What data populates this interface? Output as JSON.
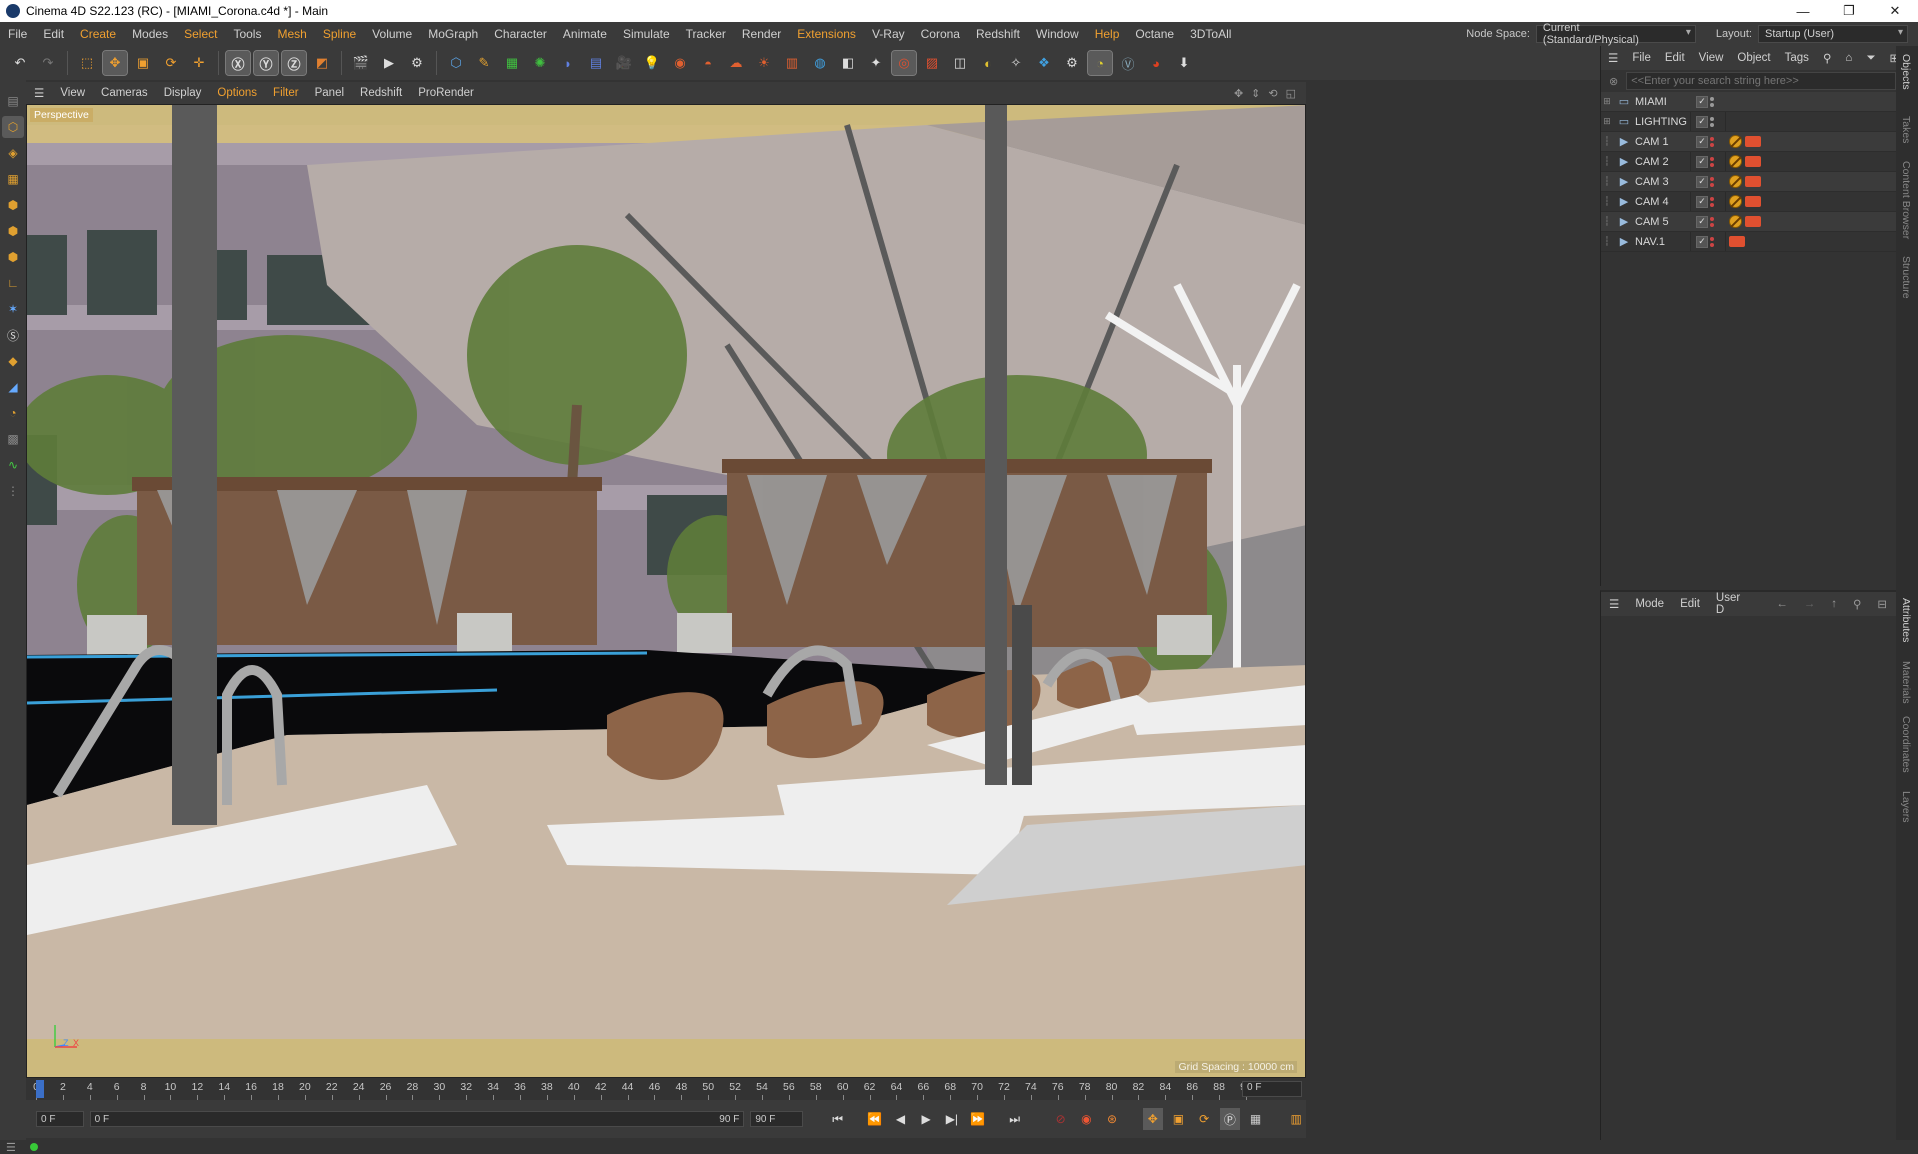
{
  "window": {
    "title": "Cinema 4D S22.123 (RC) - [MIAMI_Corona.c4d *] - Main",
    "minimize": "—",
    "restore": "❐",
    "close": "✕"
  },
  "menu": {
    "items": [
      "File",
      "Edit",
      "Create",
      "Modes",
      "Select",
      "Tools",
      "Mesh",
      "Spline",
      "Volume",
      "MoGraph",
      "Character",
      "Animate",
      "Simulate",
      "Tracker",
      "Render",
      "Extensions",
      "V-Ray",
      "Corona",
      "Redshift",
      "Window",
      "Help",
      "Octane",
      "3DToAll"
    ],
    "node_space_label": "Node Space:",
    "node_space_value": "Current (Standard/Physical)",
    "layout_label": "Layout:",
    "layout_value": "Startup (User)"
  },
  "viewport_menu": {
    "items": [
      "View",
      "Cameras",
      "Display",
      "Options",
      "Filter",
      "Panel",
      "Redshift",
      "ProRender"
    ]
  },
  "viewport": {
    "label": "Perspective",
    "grid_spacing": "Grid Spacing : 10000 cm",
    "axis_z": "Z",
    "axis_x": "X"
  },
  "timeline": {
    "ticks": [
      "0",
      "2",
      "4",
      "6",
      "8",
      "10",
      "12",
      "14",
      "16",
      "18",
      "20",
      "22",
      "24",
      "26",
      "28",
      "30",
      "32",
      "34",
      "36",
      "38",
      "40",
      "42",
      "44",
      "46",
      "48",
      "50",
      "52",
      "54",
      "56",
      "58",
      "60",
      "62",
      "64",
      "66",
      "68",
      "70",
      "72",
      "74",
      "76",
      "78",
      "80",
      "82",
      "84",
      "86",
      "88",
      "90"
    ],
    "current_frame": "0 F"
  },
  "transport": {
    "start": "0 F",
    "range_start": "0 F",
    "range_end": "90 F",
    "end": "90 F"
  },
  "object_manager": {
    "menu": [
      "File",
      "Edit",
      "View",
      "Object",
      "Tags"
    ],
    "search_placeholder": "<<Enter your search string here>>",
    "objects": [
      {
        "name": "MIAMI",
        "kind": "layer"
      },
      {
        "name": "LIGHTING",
        "kind": "layer"
      },
      {
        "name": "CAM 1",
        "kind": "camera"
      },
      {
        "name": "CAM 2",
        "kind": "camera"
      },
      {
        "name": "CAM 3",
        "kind": "camera"
      },
      {
        "name": "CAM 4",
        "kind": "camera"
      },
      {
        "name": "CAM 5",
        "kind": "camera"
      },
      {
        "name": "NAV.1",
        "kind": "camera"
      }
    ]
  },
  "attribute_manager": {
    "menu": [
      "Mode",
      "Edit",
      "User D"
    ]
  },
  "side_tabs": {
    "top": [
      "Objects",
      "Takes",
      "Content Browser",
      "Structure"
    ],
    "bottom": [
      "Attributes",
      "Materials",
      "Coordinates",
      "Layers"
    ]
  },
  "colors": {
    "accent": "#f0a030",
    "ui_bg": "#3a3a3a",
    "panel_bg": "#333333",
    "timeline_cursor": "#3b6fc7",
    "status_ok": "#38c838"
  }
}
